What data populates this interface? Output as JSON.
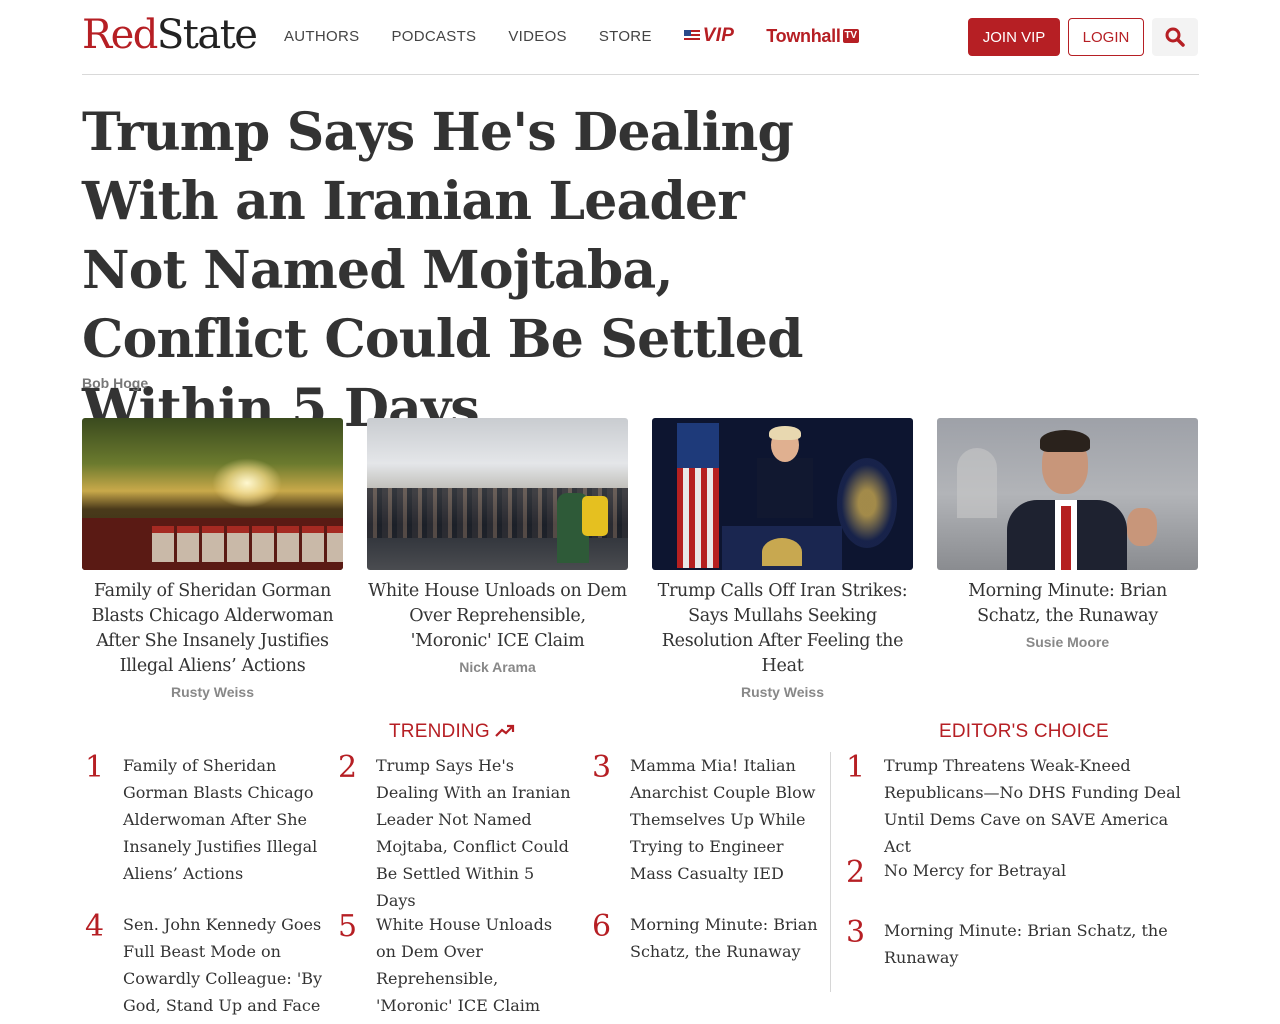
{
  "header": {
    "logo_red": "Red",
    "logo_dark": "State",
    "nav": [
      "AUTHORS",
      "PODCASTS",
      "VIDEOS",
      "STORE"
    ],
    "vip_label": "VIP",
    "townhall_label": "Townhall",
    "townhall_badge": "TV",
    "join_label": "JOIN VIP",
    "login_label": "LOGIN"
  },
  "article": {
    "headline": "Trump Says He's Dealing With an Iranian Leader Not Named Mojtaba, Conflict Could Be Settled Within 5 Days",
    "author": "Bob Hoge"
  },
  "cards": [
    {
      "title": "Family of Sheridan Gorman Blasts Chicago Alderwoman After She Insanely Justifies Illegal Aliens’ Actions",
      "author": "Rusty Weiss"
    },
    {
      "title": "White House Unloads on Dem Over Reprehensible, 'Moronic' ICE Claim",
      "author": "Nick Arama"
    },
    {
      "title": "Trump Calls Off Iran Strikes: Says Mullahs Seeking Resolution After Feeling the Heat",
      "author": "Rusty Weiss"
    },
    {
      "title": "Morning Minute: Brian Schatz, the Runaway",
      "author": "Susie Moore"
    }
  ],
  "trending": {
    "label": "TRENDING",
    "items": [
      {
        "num": "1",
        "text": "Family of Sheridan Gorman Blasts Chicago Alderwoman After She Insanely Justifies Illegal Aliens’ Actions"
      },
      {
        "num": "2",
        "text": "Trump Says He's Dealing With an Iranian Leader Not Named Mojtaba, Conflict Could Be Settled Within 5 Days"
      },
      {
        "num": "3",
        "text": "Mamma Mia! Italian Anarchist Couple Blow Themselves Up While Trying to Engineer Mass Casualty IED"
      },
      {
        "num": "4",
        "text": "Sen. John Kennedy Goes Full Beast Mode on Cowardly Colleague: 'By God, Stand Up and Face"
      },
      {
        "num": "5",
        "text": "White House Unloads on Dem Over Reprehensible, 'Moronic' ICE Claim"
      },
      {
        "num": "6",
        "text": "Morning Minute: Brian Schatz, the Runaway"
      }
    ]
  },
  "editors": {
    "label": "EDITOR'S CHOICE",
    "items": [
      {
        "num": "1",
        "text": "Trump Threatens Weak-Kneed Republicans—No DHS Funding Deal Until Dems Cave on SAVE America Act"
      },
      {
        "num": "2",
        "text": "No Mercy for Betrayal"
      },
      {
        "num": "3",
        "text": "Morning Minute: Brian Schatz, the Runaway"
      }
    ]
  },
  "colors": {
    "brand_red": "#b61f24",
    "text": "#333333",
    "muted": "#888888"
  }
}
